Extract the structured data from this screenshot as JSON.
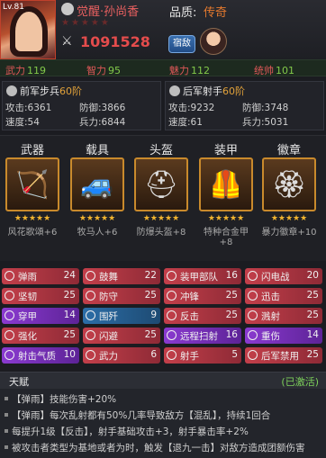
{
  "header": {
    "level": "Lv.81",
    "hero_name": "觉醒·孙尚香",
    "stars": "★★★★★",
    "power": "1091528",
    "quality_label": "品质:",
    "quality_value": "传奇",
    "fate_button": "宿敌",
    "icons": [
      "skull-icon",
      "sword-icon"
    ]
  },
  "stats": [
    {
      "label": "武力",
      "value": "119"
    },
    {
      "label": "智力",
      "value": "95"
    },
    {
      "label": "魅力",
      "value": "112"
    },
    {
      "label": "统帅",
      "value": "101"
    }
  ],
  "armies": [
    {
      "title": "前军步兵",
      "level": "60阶",
      "attack_label": "攻击:",
      "attack": "6361",
      "defense_label": "防御:",
      "defense": "3866",
      "speed_label": "速度:",
      "speed": "54",
      "troops_label": "兵力:",
      "troops": "6844"
    },
    {
      "title": "后军射手",
      "level": "60阶",
      "attack_label": "攻击:",
      "attack": "9232",
      "defense_label": "防御:",
      "defense": "3748",
      "speed_label": "速度:",
      "speed": "61",
      "troops_label": "兵力:",
      "troops": "5031"
    }
  ],
  "equipment": [
    {
      "slot": "武器",
      "stars": "★★★★★",
      "name": "风花歌頌+6",
      "icon": "bow-icon",
      "glyph": "🏹"
    },
    {
      "slot": "载具",
      "stars": "★★★★★",
      "name": "牧马人+6",
      "icon": "vehicle-icon",
      "glyph": "🚙"
    },
    {
      "slot": "头盔",
      "stars": "★★★★★",
      "name": "防爆头盔+8",
      "icon": "helmet-icon",
      "glyph": "⛑"
    },
    {
      "slot": "装甲",
      "stars": "★★★★★",
      "name": "特种合金甲+8",
      "icon": "armor-icon",
      "glyph": "🦺"
    },
    {
      "slot": "徽章",
      "stars": "★★★★★",
      "name": "暴力徽章+10",
      "icon": "badge-icon",
      "glyph": "🏵"
    }
  ],
  "talents": [
    {
      "name": "弹雨",
      "count": "24",
      "color": "red"
    },
    {
      "name": "鼓舞",
      "count": "22",
      "color": "red"
    },
    {
      "name": "装甲部队",
      "count": "16",
      "color": "red"
    },
    {
      "name": "闪电战",
      "count": "20",
      "color": "red"
    },
    {
      "name": "坚韧",
      "count": "25",
      "color": "red"
    },
    {
      "name": "防守",
      "count": "25",
      "color": "red"
    },
    {
      "name": "冲锋",
      "count": "25",
      "color": "red"
    },
    {
      "name": "迅击",
      "count": "25",
      "color": "red"
    },
    {
      "name": "穿甲",
      "count": "14",
      "color": "purple"
    },
    {
      "name": "围歼",
      "count": "9",
      "color": "blue"
    },
    {
      "name": "反击",
      "count": "25",
      "color": "red"
    },
    {
      "name": "溅射",
      "count": "25",
      "color": "red"
    },
    {
      "name": "强化",
      "count": "25",
      "color": "red"
    },
    {
      "name": "闪避",
      "count": "25",
      "color": "red"
    },
    {
      "name": "远程扫射",
      "count": "16",
      "color": "purple"
    },
    {
      "name": "重伤",
      "count": "14",
      "color": "purple"
    },
    {
      "name": "射击气质",
      "count": "10",
      "color": "purple"
    },
    {
      "name": "武力",
      "count": "6",
      "color": "red"
    },
    {
      "name": "射手",
      "count": "5",
      "color": "red"
    },
    {
      "name": "后军禁用",
      "count": "25",
      "color": "red"
    }
  ],
  "tianfu": {
    "title": "天赋",
    "status": "(已激活)",
    "lines": [
      "【弹雨】技能伤害+20%",
      "【弹雨】每次乱射都有50%几率导致敌方【混乱】，持续1回合",
      "每提升1级【反击】，射手基础攻击+3，射手暴击率+2%",
      "被攻击者类型为基地或者为时，触发【退九一击】对敌方造成团额伤害"
    ]
  }
}
